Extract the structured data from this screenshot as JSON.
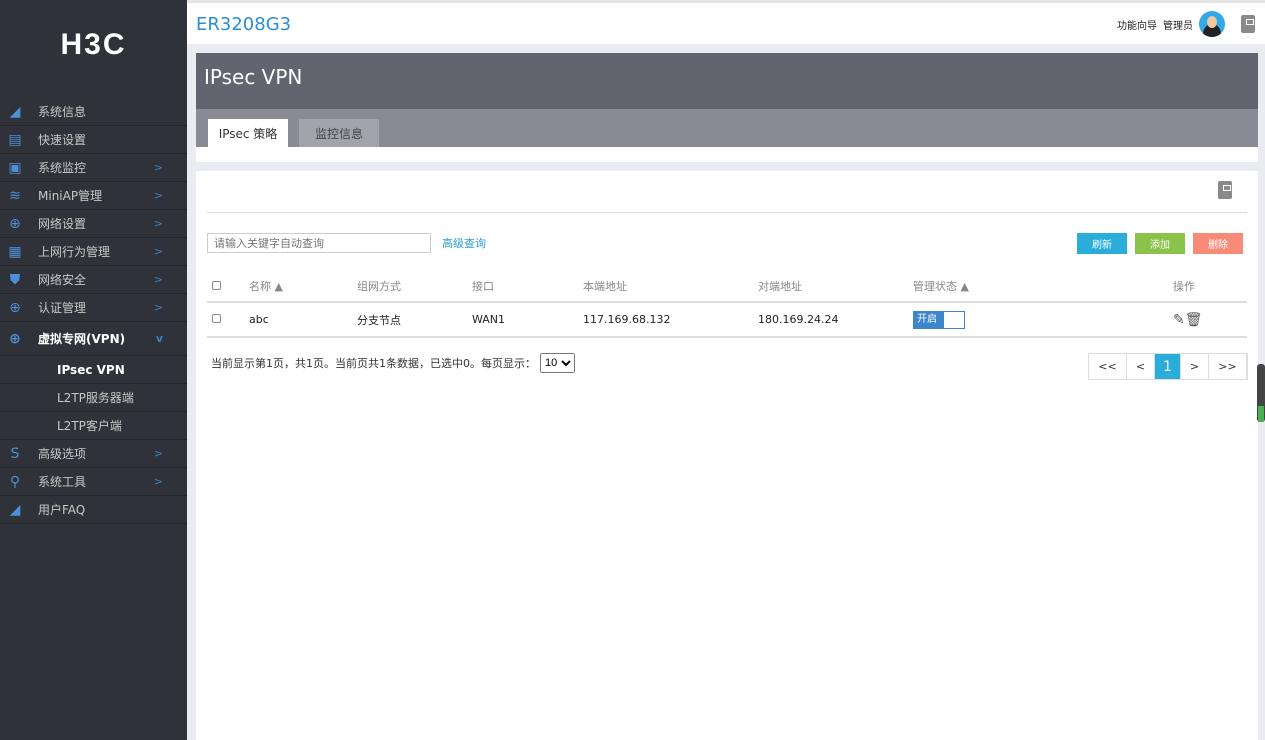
{
  "logo": "H3C",
  "header": {
    "title": "ER3208G3",
    "wizard": "功能向导",
    "user": "管理员"
  },
  "sidebar": {
    "items": [
      {
        "label": "系统信息",
        "icon": "speedometer-icon",
        "sym": "◢"
      },
      {
        "label": "快速设置",
        "icon": "quick-setup-icon",
        "sym": "▤"
      },
      {
        "label": "系统监控",
        "icon": "monitor-icon",
        "sym": "▣",
        "chev": ">"
      },
      {
        "label": "MiniAP管理",
        "icon": "wifi-icon",
        "sym": "≋",
        "chev": ">"
      },
      {
        "label": "网络设置",
        "icon": "globe-icon",
        "sym": "⊕",
        "chev": ">"
      },
      {
        "label": "上网行为管理",
        "icon": "behavior-icon",
        "sym": "▦",
        "chev": ">"
      },
      {
        "label": "网络安全",
        "icon": "shield-icon",
        "sym": "⛊",
        "chev": ">"
      },
      {
        "label": "认证管理",
        "icon": "globe-icon",
        "sym": "⊕",
        "chev": ">"
      },
      {
        "label": "虚拟专网(VPN)",
        "icon": "vpn-globe-icon",
        "sym": "⊕",
        "chev": "v"
      }
    ],
    "sub": [
      "IPsec VPN",
      "L2TP服务器端",
      "L2TP客户端"
    ],
    "items2": [
      {
        "label": "高级选项",
        "icon": "advanced-icon",
        "sym": "S",
        "chev": ">"
      },
      {
        "label": "系统工具",
        "icon": "tools-icon",
        "sym": "⚲",
        "chev": ">"
      },
      {
        "label": "用户FAQ",
        "icon": "speedometer-icon",
        "sym": "◢"
      }
    ]
  },
  "page": {
    "title": "IPsec VPN",
    "tabs": [
      "IPsec 策略",
      "监控信息"
    ]
  },
  "toolbar": {
    "search_placeholder": "请输入关键字自动查询",
    "advanced": "高级查询",
    "refresh": "刷新",
    "add": "添加",
    "delete": "删除"
  },
  "table": {
    "headers": [
      "名称 ▲",
      "组网方式",
      "接口",
      "本端地址",
      "对端地址",
      "管理状态 ▲",
      "操作"
    ],
    "rows": [
      {
        "name": "abc",
        "mode": "分支节点",
        "iface": "WAN1",
        "local": "117.169.68.132",
        "peer": "180.169.24.24",
        "status": "开启"
      }
    ]
  },
  "footer": {
    "summary": "当前显示第1页，共1页。当前页共1条数据，已选中0。每页显示：",
    "per_page": "10"
  },
  "pager": [
    "<<",
    "<",
    "1",
    ">",
    ">>"
  ]
}
